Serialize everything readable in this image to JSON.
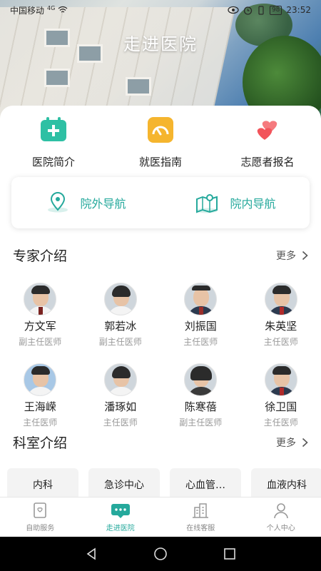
{
  "status_bar": {
    "carrier": "中国移动",
    "network": "4G",
    "battery": "98",
    "time": "23:52"
  },
  "header": {
    "title": "走进医院"
  },
  "quick_links": [
    {
      "label": "医院简介",
      "icon": "hospital-plus-icon",
      "color": "#2ec0a4"
    },
    {
      "label": "就医指南",
      "icon": "guide-gauge-icon",
      "color": "#f5b52e"
    },
    {
      "label": "志愿者报名",
      "icon": "volunteer-hearts-icon",
      "color": "#f2545b"
    }
  ],
  "navigation": [
    {
      "label": "院外导航",
      "icon": "map-pin-icon"
    },
    {
      "label": "院内导航",
      "icon": "map-folded-icon"
    }
  ],
  "experts_section": {
    "title": "专家介绍",
    "more": "更多"
  },
  "experts": [
    {
      "name": "方文军",
      "title": "副主任医师"
    },
    {
      "name": "郭若冰",
      "title": "副主任医师"
    },
    {
      "name": "刘振国",
      "title": "主任医师"
    },
    {
      "name": "朱英坚",
      "title": "主任医师"
    },
    {
      "name": "王海嵘",
      "title": "主任医师"
    },
    {
      "name": "潘琢如",
      "title": "主任医师"
    },
    {
      "name": "陈寒蓓",
      "title": "副主任医师"
    },
    {
      "name": "徐卫国",
      "title": "主任医师"
    }
  ],
  "departments_section": {
    "title": "科室介绍",
    "more": "更多"
  },
  "departments": [
    "内科",
    "急诊中心",
    "心血管…",
    "血液内科"
  ],
  "tabbar": [
    {
      "label": "自助服务",
      "icon": "self-service-icon",
      "active": false
    },
    {
      "label": "走进医院",
      "icon": "chat-bubble-icon",
      "active": true
    },
    {
      "label": "在线客服",
      "icon": "building-icon",
      "active": false
    },
    {
      "label": "个人中心",
      "icon": "person-icon",
      "active": false
    }
  ],
  "colors": {
    "accent": "#25a99c",
    "text": "#222222",
    "muted": "#9a9a9a"
  }
}
